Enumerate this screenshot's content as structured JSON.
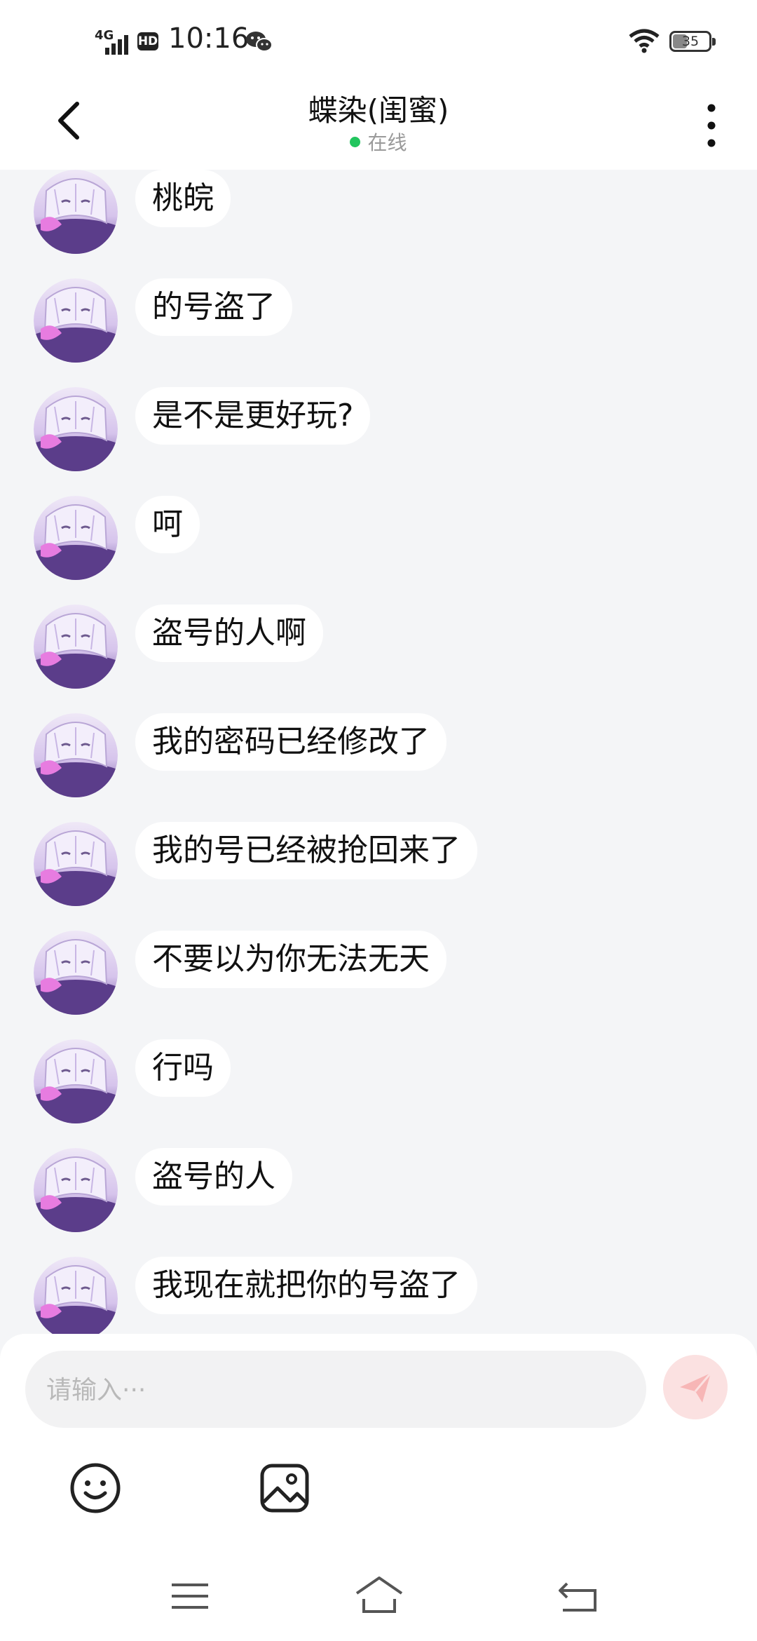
{
  "status_bar": {
    "network": "4G",
    "hd_badge": "HD",
    "time": "10:16",
    "battery": "35",
    "icons": [
      "signal-icon",
      "wechat-icon",
      "wifi-icon",
      "battery-icon"
    ]
  },
  "header": {
    "title": "蝶染(闺蜜)",
    "status": "在线",
    "status_color": "#22c55e"
  },
  "messages": [
    {
      "text": "桃皖"
    },
    {
      "text": "的号盗了"
    },
    {
      "text": "是不是更好玩?"
    },
    {
      "text": "呵"
    },
    {
      "text": "盗号的人啊"
    },
    {
      "text": "我的密码已经修改了"
    },
    {
      "text": "我的号已经被抢回来了"
    },
    {
      "text": "不要以为你无法无天"
    },
    {
      "text": "行吗"
    },
    {
      "text": "盗号的人"
    },
    {
      "text": "我现在就把你的号盗了"
    }
  ],
  "composer": {
    "placeholder": "请输入···",
    "send_color": "#f7b6b6"
  },
  "toolbar": {
    "icons": [
      "emoji-icon",
      "image-icon"
    ]
  },
  "nav": {
    "icons": [
      "menu-icon",
      "home-icon",
      "back-icon"
    ]
  }
}
